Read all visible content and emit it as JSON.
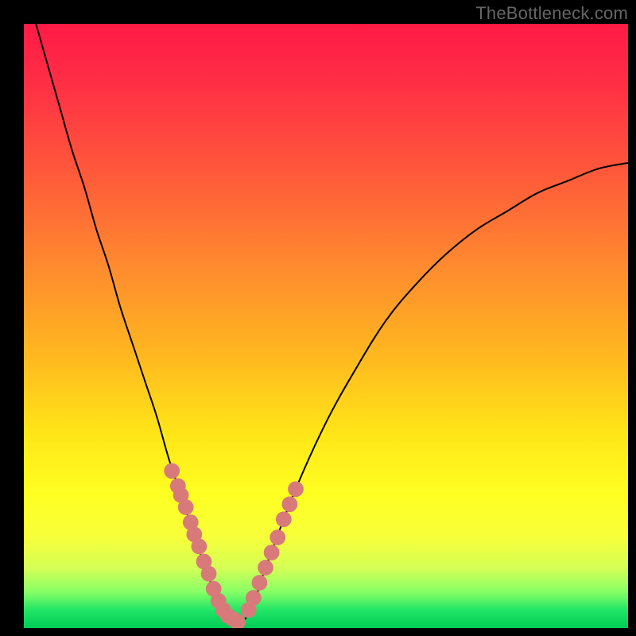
{
  "watermark": "TheBottleneck.com",
  "chart_data": {
    "type": "line",
    "title": "",
    "xlabel": "",
    "ylabel": "",
    "xlim": [
      0,
      100
    ],
    "ylim": [
      0,
      100
    ],
    "grid": false,
    "legend": "none",
    "annotations": [],
    "curve": {
      "name": "bottleneck-curve",
      "color": "#000000",
      "x": [
        2,
        4,
        6,
        8,
        10,
        12,
        14,
        16,
        18,
        20,
        22,
        24,
        26,
        28,
        30,
        32,
        34,
        36,
        38,
        40,
        45,
        50,
        55,
        60,
        65,
        70,
        75,
        80,
        85,
        90,
        95,
        100
      ],
      "y": [
        100,
        93,
        86,
        79,
        73,
        66,
        60,
        53,
        47,
        41,
        35,
        28,
        22,
        16,
        10,
        5,
        2,
        1,
        4,
        10,
        23,
        34,
        43,
        51,
        57,
        62,
        66,
        69,
        72,
        74,
        76,
        77
      ]
    },
    "scatter": {
      "name": "sample-dots",
      "color": "#d87a7a",
      "radius": 1.3,
      "x": [
        24.5,
        25.5,
        26.0,
        26.8,
        27.6,
        28.2,
        29.0,
        29.8,
        30.6,
        31.4,
        32.2,
        33.0,
        33.8,
        34.6,
        35.4,
        37.2,
        38.0,
        39.0,
        40.0,
        41.0,
        42.0,
        43.0,
        44.0,
        45.0
      ],
      "y": [
        26.0,
        23.5,
        22.0,
        20.0,
        17.5,
        15.5,
        13.5,
        11.0,
        9.0,
        6.5,
        4.5,
        3.0,
        2.0,
        1.5,
        1.0,
        3.0,
        5.0,
        7.5,
        10.0,
        12.5,
        15.0,
        18.0,
        20.5,
        23.0
      ]
    },
    "optimal_x": 35
  }
}
